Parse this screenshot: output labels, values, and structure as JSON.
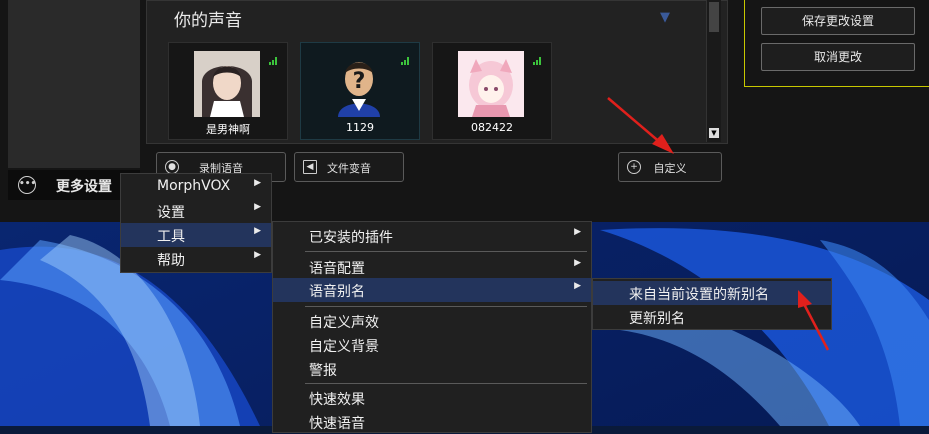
{
  "app": {
    "voices_title": "你的声音",
    "voices": [
      {
        "name": "是男神啊"
      },
      {
        "name": "1129"
      },
      {
        "name": "082422"
      }
    ],
    "buttons": {
      "record": "录制语音",
      "file_voice": "文件变音",
      "custom": "自定义"
    },
    "right_buttons": {
      "save": "保存更改设置",
      "cancel": "取消更改"
    },
    "more_settings": "更多设置"
  },
  "menu1": {
    "items": [
      {
        "label": "MorphVOX",
        "submenu": true
      },
      {
        "label": "设置",
        "submenu": true
      },
      {
        "label": "工具",
        "submenu": true,
        "highlighted": true
      },
      {
        "label": "帮助",
        "submenu": true
      }
    ]
  },
  "menu2": {
    "items": [
      {
        "label": "已安装的插件",
        "submenu": true
      },
      {
        "label": "语音配置",
        "submenu": true
      },
      {
        "label": "语音别名",
        "submenu": true,
        "highlighted": true
      },
      {
        "label": "自定义声效"
      },
      {
        "label": "自定义背景"
      },
      {
        "label": "警报"
      },
      {
        "label": "快速效果"
      },
      {
        "label": "快速语音"
      }
    ]
  },
  "menu3": {
    "items": [
      {
        "label": "来自当前设置的新别名",
        "highlighted": true
      },
      {
        "label": "更新别名"
      }
    ]
  },
  "colors": {
    "accent_yellow": "#c8c800",
    "menu_highlight": "#23345c",
    "signal_green": "#3cc43c",
    "annotation_red": "#e0201c"
  }
}
